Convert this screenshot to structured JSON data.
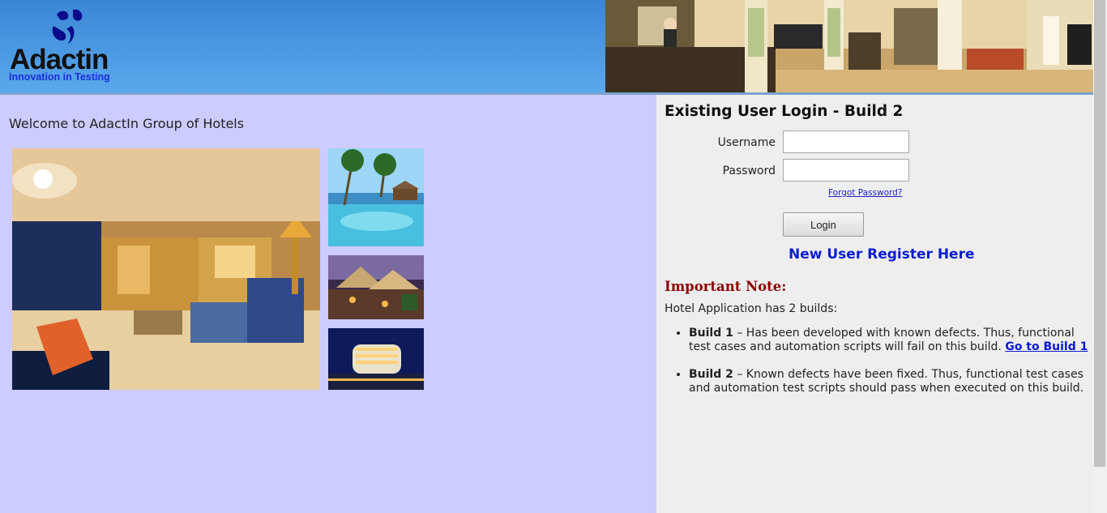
{
  "header": {
    "logo_name": "Adactin",
    "logo_tagline": "Innovation in Testing"
  },
  "main": {
    "welcome": "Welcome to AdactIn Group of Hotels"
  },
  "login": {
    "title": "Existing User Login - Build 2",
    "username_label": "Username",
    "password_label": "Password",
    "username_value": "",
    "password_value": "",
    "forgot_password": "Forgot Password?",
    "login_button": "Login",
    "register_link": "New User Register Here"
  },
  "note": {
    "title": "Important Note:",
    "intro": "Hotel Application has 2 builds:",
    "build1_name": "Build 1",
    "build1_text": " – Has been developed with known defects. Thus, functional test cases and automation scripts will fail on this build. ",
    "build1_link": "Go to Build 1",
    "build2_name": "Build 2",
    "build2_text": " – Known defects have been fixed. Thus, functional test cases and automation test scripts should pass when executed on this build."
  },
  "colors": {
    "header_blue": "#3a86d6",
    "left_bg": "#ccccff",
    "right_bg": "#eeeeee",
    "note_red": "#8a0000",
    "link_blue": "#0b1bd0"
  }
}
